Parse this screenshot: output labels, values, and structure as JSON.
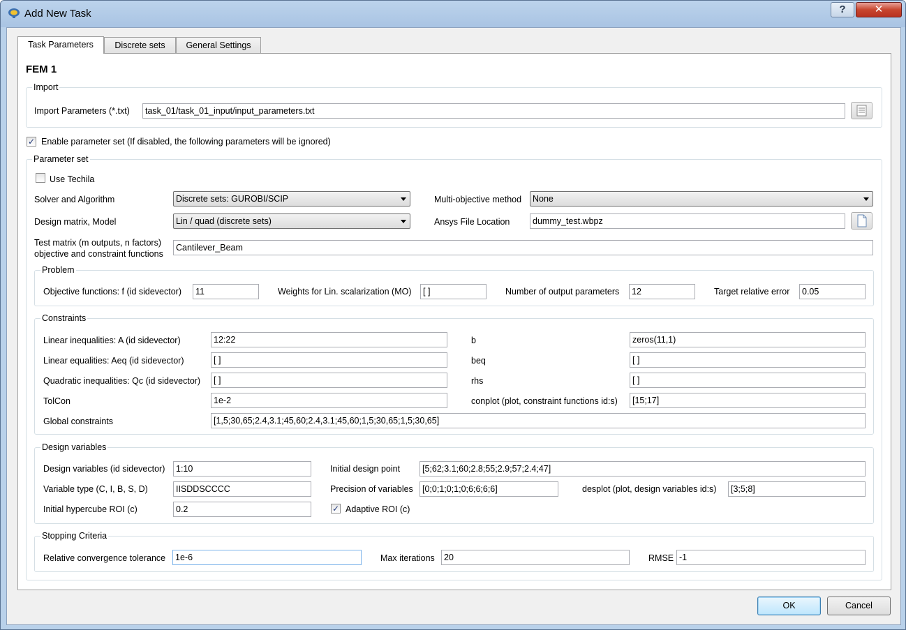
{
  "window": {
    "title": "Add New Task",
    "help_label": "?",
    "close_label": "✕"
  },
  "tabs": [
    {
      "label": "Task Parameters",
      "active": true
    },
    {
      "label": "Discrete sets",
      "active": false
    },
    {
      "label": "General Settings",
      "active": false
    }
  ],
  "task_title": "FEM 1",
  "import": {
    "group_label": "Import",
    "params_label": "Import Parameters (*.txt)",
    "params_value": "task_01/task_01_input/input_parameters.txt",
    "browse_icon": "list-document-icon"
  },
  "enable_set": {
    "label": "Enable parameter set (If disabled, the following parameters will be ignored)",
    "checked": true
  },
  "param_set": {
    "group_label": "Parameter set",
    "use_techila": {
      "label": "Use Techila",
      "checked": false
    },
    "solver_label": "Solver and Algorithm",
    "solver_value": "Discrete sets: GUROBI/SCIP",
    "mo_method_label": "Multi-objective method",
    "mo_method_value": "None",
    "design_matrix_label": "Design matrix, Model",
    "design_matrix_value": "Lin / quad (discrete sets)",
    "ansys_label": "Ansys File Location",
    "ansys_value": "dummy_test.wbpz",
    "ansys_icon": "document-icon",
    "test_matrix_label_1": "Test matrix (m outputs, n factors)",
    "test_matrix_label_2": "objective and constraint functions",
    "test_matrix_value": "Cantilever_Beam"
  },
  "problem": {
    "group_label": "Problem",
    "objective_label": "Objective functions: f (id sidevector)",
    "objective_value": "11",
    "weights_label": "Weights for Lin. scalarization (MO)",
    "weights_value": "[ ]",
    "num_outputs_label": "Number of output parameters",
    "num_outputs_value": "12",
    "target_error_label": "Target relative error",
    "target_error_value": "0.05"
  },
  "constraints": {
    "group_label": "Constraints",
    "lin_ineq_label": "Linear inequalities: A (id sidevector)",
    "lin_ineq_value": "12:22",
    "b_label": "b",
    "b_value": "zeros(11,1)",
    "lin_eq_label": "Linear equalities: Aeq (id sidevector)",
    "lin_eq_value": "[ ]",
    "beq_label": "beq",
    "beq_value": "[ ]",
    "quad_ineq_label": "Quadratic inequalities: Qc (id sidevector)",
    "quad_ineq_value": "[ ]",
    "rhs_label": "rhs",
    "rhs_value": "[ ]",
    "tolcon_label": "TolCon",
    "tolcon_value": "1e-2",
    "conplot_label": "conplot (plot, constraint functions id:s)",
    "conplot_value": "[15;17]",
    "global_label": "Global constraints",
    "global_value": "[1,5;30,65;2.4,3.1;45,60;2.4,3.1;45,60;1,5;30,65;1,5;30,65]"
  },
  "design_vars": {
    "group_label": "Design variables",
    "dv_label": "Design variables (id sidevector)",
    "dv_value": "1:10",
    "init_point_label": "Initial design point",
    "init_point_value": "[5;62;3.1;60;2.8;55;2.9;57;2.4;47]",
    "var_type_label": "Variable type (C, I, B, S, D)",
    "var_type_value": "IISDDSCCCC",
    "precision_label": "Precision of variables",
    "precision_value": "[0;0;1;0;1;0;6;6;6;6]",
    "desplot_label": "desplot (plot, design variables id:s)",
    "desplot_value": "[3;5;8]",
    "hypercube_label": "Initial hypercube ROI (c)",
    "hypercube_value": "0.2",
    "adaptive_label": "Adaptive ROI (c)",
    "adaptive_checked": true
  },
  "stopping": {
    "group_label": "Stopping Criteria",
    "rel_tol_label": "Relative convergence tolerance",
    "rel_tol_value": "1e-6",
    "max_iter_label": "Max iterations",
    "max_iter_value": "20",
    "rmse_label": "RMSE",
    "rmse_value": "-1"
  },
  "buttons": {
    "ok": "OK",
    "cancel": "Cancel"
  }
}
